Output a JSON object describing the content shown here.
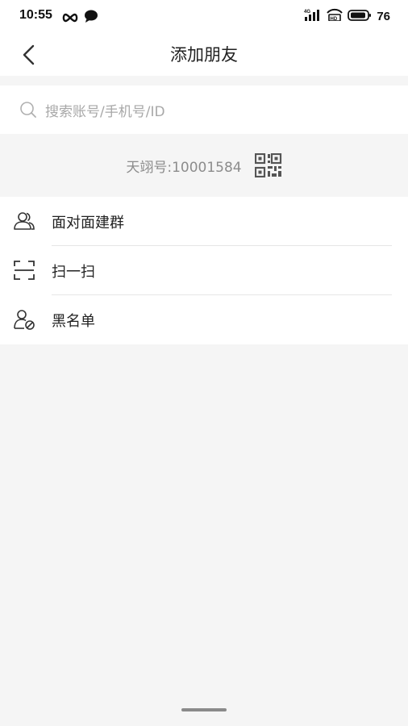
{
  "status_bar": {
    "time": "10:55",
    "battery": "76",
    "network": "4G"
  },
  "nav": {
    "title": "添加朋友"
  },
  "search": {
    "placeholder": "搜索账号/手机号/ID"
  },
  "account": {
    "id_text": "天翊号:10001584"
  },
  "menu": {
    "items": [
      {
        "label": "面对面建群",
        "icon": "people-icon"
      },
      {
        "label": "扫一扫",
        "icon": "scan-icon"
      },
      {
        "label": "黑名单",
        "icon": "blocked-user-icon"
      }
    ]
  }
}
